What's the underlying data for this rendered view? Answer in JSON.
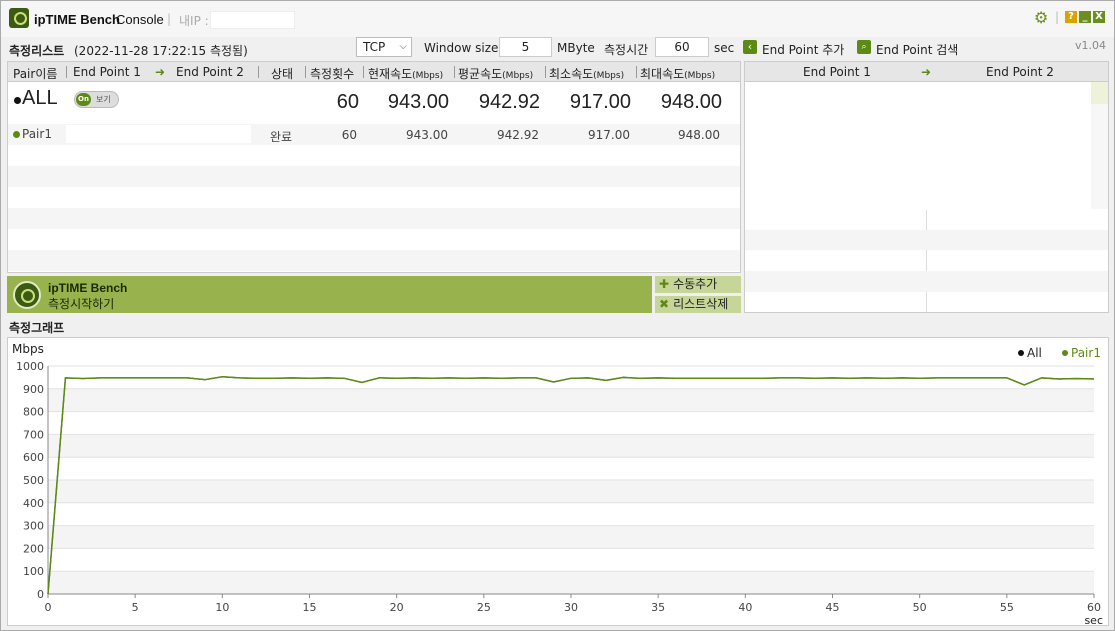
{
  "titlebar": {
    "brand": "ipTIME Bench",
    "console": "Console",
    "separator": "|",
    "ip_label": "내IP :",
    "ip_value": "",
    "help": "?",
    "minimize": "_",
    "close": "X"
  },
  "toolbar": {
    "section_title": "측정리스트",
    "measured_at": "(2022-11-28 17:22:15 측정됨)",
    "protocol": "TCP",
    "window_size_label": "Window size",
    "window_size": "5",
    "window_unit": "MByte",
    "duration_label": "측정시간",
    "duration": "60",
    "duration_unit": "sec",
    "add_endpoint": "End Point 추가",
    "search_endpoint": "End Point 검색",
    "version": "v1.04"
  },
  "table": {
    "headers": {
      "pair": "Pair이름",
      "ep1": "End Point 1",
      "arrow": "➜",
      "ep2": "End Point 2",
      "status": "상태",
      "count": "측정횟수",
      "current": "현재속도",
      "avg": "평균속도",
      "min": "최소속도",
      "max": "최대속도",
      "unit": "(Mbps)"
    },
    "all": {
      "name": "ALL",
      "toggle_on": "On",
      "toggle_label": "보기",
      "count": "60",
      "current": "943.00",
      "avg": "942.92",
      "min": "917.00",
      "max": "948.00"
    },
    "pairs": [
      {
        "name": "Pair1",
        "status": "완료",
        "count": "60",
        "current": "943.00",
        "avg": "942.92",
        "min": "917.00",
        "max": "948.00"
      }
    ]
  },
  "right_panel": {
    "ep1": "End Point 1",
    "ep2": "End Point 2",
    "arrow": "➜"
  },
  "bench": {
    "title": "ipTIME Bench",
    "subtitle": "측정시작하기",
    "add_manual": "수동추가",
    "delete_list": "리스트삭제"
  },
  "graph": {
    "section_title": "측정그래프",
    "accent": "#5c8a14"
  },
  "chart_data": {
    "type": "line",
    "ylabel": "Mbps",
    "xlabel": "sec",
    "xlim": [
      0,
      60
    ],
    "ylim": [
      0,
      1000
    ],
    "xticks": [
      0,
      5,
      10,
      15,
      20,
      25,
      30,
      35,
      40,
      45,
      50,
      55,
      60
    ],
    "yticks": [
      0,
      100,
      200,
      300,
      400,
      500,
      600,
      700,
      800,
      900,
      1000
    ],
    "legend": "top-right",
    "series": [
      {
        "name": "All",
        "color": "#111111",
        "x": [
          0,
          1,
          2,
          3,
          4,
          5,
          6,
          7,
          8,
          9,
          10,
          11,
          12,
          13,
          14,
          15,
          16,
          17,
          18,
          19,
          20,
          21,
          22,
          23,
          24,
          25,
          26,
          27,
          28,
          29,
          30,
          31,
          32,
          33,
          34,
          35,
          36,
          37,
          38,
          39,
          40,
          41,
          42,
          43,
          44,
          45,
          46,
          47,
          48,
          49,
          50,
          51,
          52,
          53,
          54,
          55,
          56,
          57,
          58,
          59,
          60
        ],
        "values": [
          0,
          948,
          945,
          948,
          948,
          948,
          948,
          948,
          948,
          940,
          953,
          948,
          946,
          946,
          948,
          946,
          948,
          946,
          928,
          948,
          946,
          948,
          946,
          948,
          946,
          948,
          946,
          948,
          948,
          930,
          946,
          948,
          937,
          950,
          946,
          948,
          946,
          946,
          946,
          946,
          946,
          946,
          948,
          948,
          946,
          948,
          946,
          948,
          946,
          948,
          946,
          948,
          948,
          948,
          948,
          948,
          917,
          948,
          943,
          945,
          943
        ]
      },
      {
        "name": "Pair1",
        "color": "#5c8a14",
        "x": [
          0,
          1,
          2,
          3,
          4,
          5,
          6,
          7,
          8,
          9,
          10,
          11,
          12,
          13,
          14,
          15,
          16,
          17,
          18,
          19,
          20,
          21,
          22,
          23,
          24,
          25,
          26,
          27,
          28,
          29,
          30,
          31,
          32,
          33,
          34,
          35,
          36,
          37,
          38,
          39,
          40,
          41,
          42,
          43,
          44,
          45,
          46,
          47,
          48,
          49,
          50,
          51,
          52,
          53,
          54,
          55,
          56,
          57,
          58,
          59,
          60
        ],
        "values": [
          0,
          948,
          945,
          948,
          948,
          948,
          948,
          948,
          948,
          940,
          953,
          948,
          946,
          946,
          948,
          946,
          948,
          946,
          928,
          948,
          946,
          948,
          946,
          948,
          946,
          948,
          946,
          948,
          948,
          930,
          946,
          948,
          937,
          950,
          946,
          948,
          946,
          946,
          946,
          946,
          946,
          946,
          948,
          948,
          946,
          948,
          946,
          948,
          946,
          948,
          946,
          948,
          948,
          948,
          948,
          948,
          917,
          948,
          943,
          945,
          943
        ]
      }
    ]
  }
}
